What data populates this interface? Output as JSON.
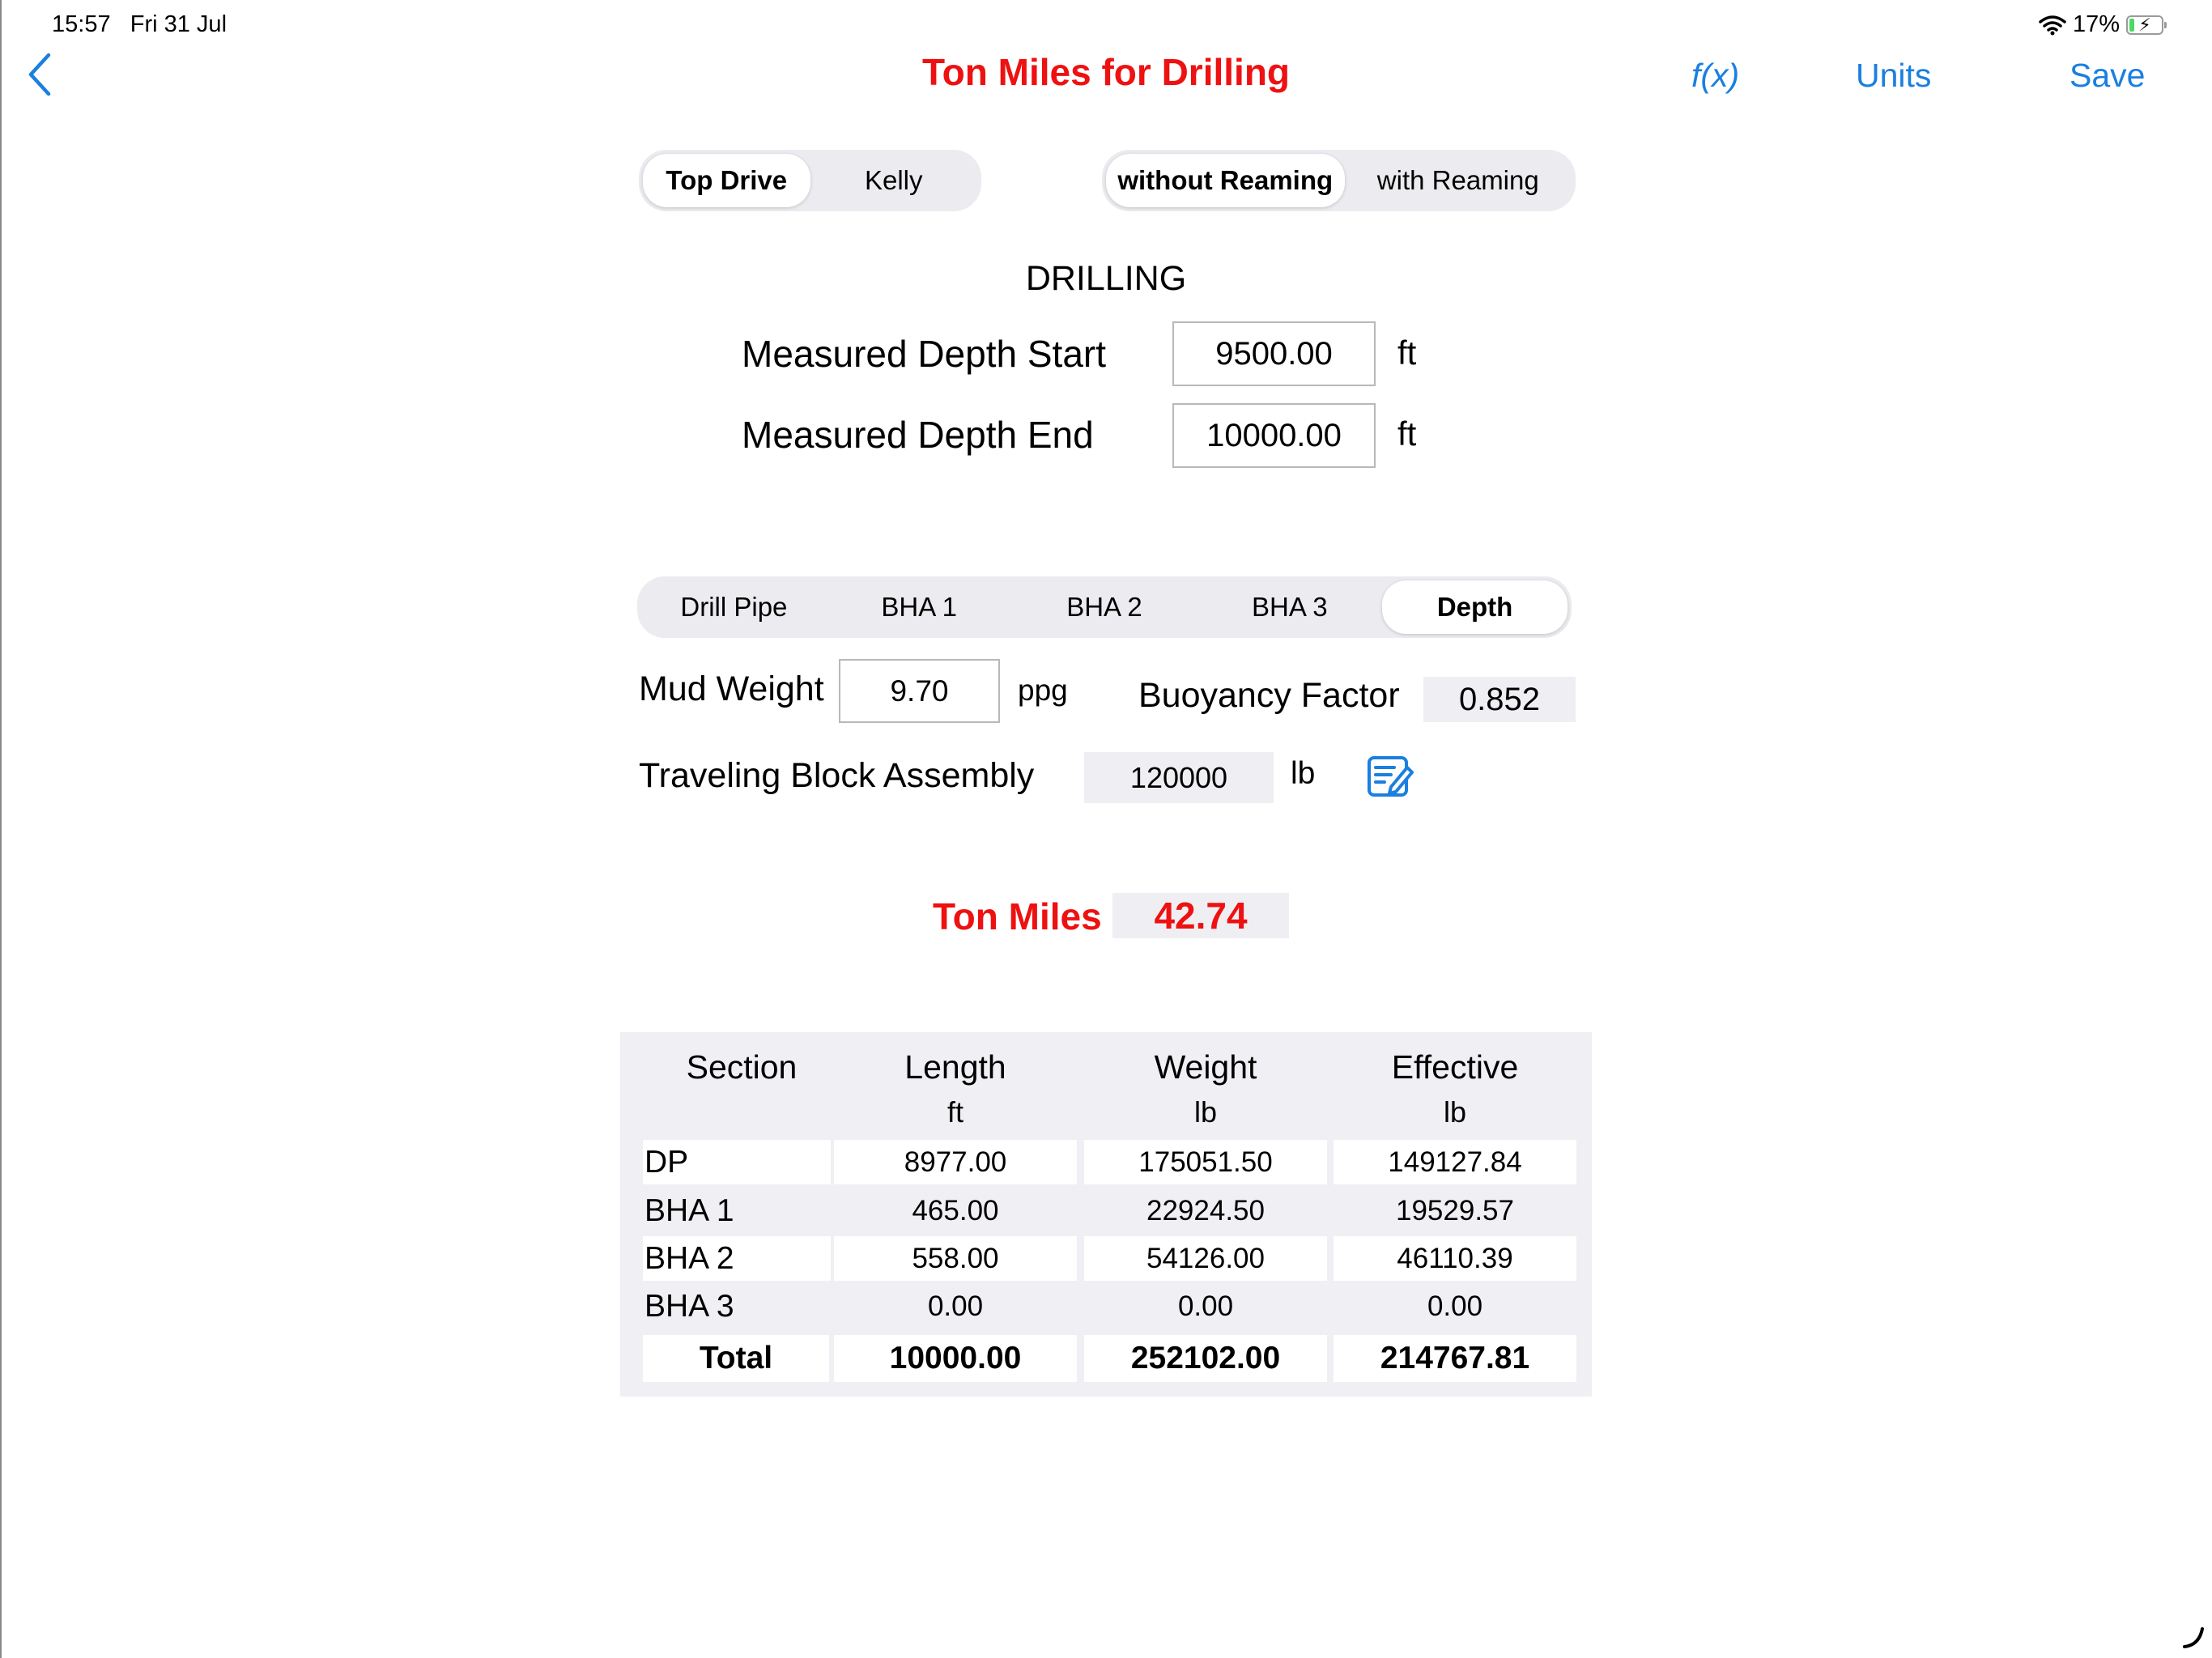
{
  "status_bar": {
    "time": "15:57",
    "date": "Fri 31 Jul",
    "battery": "17%",
    "battery_level": 0.17
  },
  "nav": {
    "back_icon": "chevron-left-icon",
    "title": "Ton Miles for Drilling",
    "fx_label": "f(x)",
    "units_label": "Units",
    "save_label": "Save"
  },
  "drive_seg": {
    "options": [
      "Top Drive",
      "Kelly"
    ],
    "selected": 0
  },
  "ream_seg": {
    "options": [
      "without Reaming",
      "with Reaming"
    ],
    "selected": 0
  },
  "drilling": {
    "heading": "DRILLING",
    "md_start": {
      "label": "Measured Depth Start",
      "value": "9500.00",
      "unit": "ft"
    },
    "md_end": {
      "label": "Measured Depth End",
      "value": "10000.00",
      "unit": "ft"
    }
  },
  "tabs": {
    "options": [
      "Drill Pipe",
      "BHA 1",
      "BHA 2",
      "BHA 3",
      "Depth"
    ],
    "selected": 4
  },
  "params": {
    "mud_weight": {
      "label": "Mud Weight",
      "value": "9.70",
      "unit": "ppg"
    },
    "buoyancy": {
      "label": "Buoyancy Factor",
      "value": "0.852"
    },
    "tba": {
      "label": "Traveling Block Assembly",
      "value": "120000",
      "unit": "lb",
      "edit_icon": "edit-note-icon"
    }
  },
  "result": {
    "label": "Ton Miles",
    "value": "42.74"
  },
  "table": {
    "headers": [
      "Section",
      "Length",
      "Weight",
      "Effective"
    ],
    "units": [
      "",
      "ft",
      "lb",
      "lb"
    ],
    "rows": [
      [
        "DP",
        "8977.00",
        "175051.50",
        "149127.84"
      ],
      [
        "BHA 1",
        "465.00",
        "22924.50",
        "19529.57"
      ],
      [
        "BHA 2",
        "558.00",
        "54126.00",
        "46110.39"
      ],
      [
        "BHA 3",
        "0.00",
        "0.00",
        "0.00"
      ]
    ],
    "total": [
      "Total",
      "10000.00",
      "252102.00",
      "214767.81"
    ]
  },
  "colors": {
    "accent": "#1a7fe0",
    "title_red": "#ee1111",
    "segment_bg": "#ececf0",
    "table_bg": "#efeff4"
  }
}
